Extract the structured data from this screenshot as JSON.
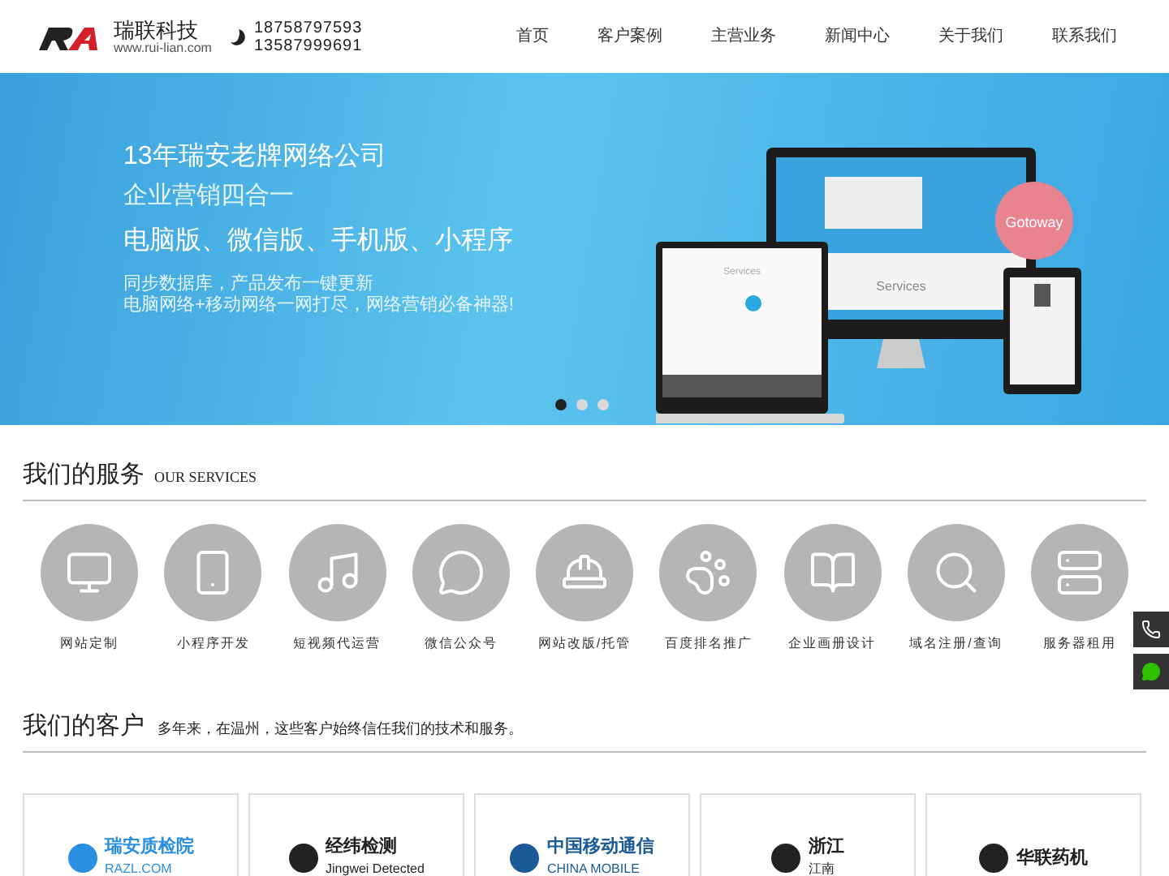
{
  "header": {
    "brand": "瑞联科技",
    "url": "www.rui-lian.com",
    "phones": [
      "18758797593",
      "13587999691"
    ],
    "nav": [
      {
        "label": "首页",
        "selected": false
      },
      {
        "label": "客户案例",
        "selected": false
      },
      {
        "label": "主营业务",
        "selected": false
      },
      {
        "label": "新闻中心",
        "selected": false
      },
      {
        "label": "关于我们",
        "selected": false
      },
      {
        "label": "联系我们",
        "selected": false
      }
    ]
  },
  "banner": {
    "headline": "13年瑞安老牌网络公司",
    "subhead": "企业营销四合一",
    "versions": "电脑版、微信版、手机版、小程序",
    "lines": [
      "同步数据库，产品发布一键更新",
      "电脑网络+移动网络一网打尽，网络营销必备神器!"
    ],
    "mockup": {
      "badge": "Gotoway",
      "monitor_text": "Services",
      "laptop_text": "Services"
    },
    "dots": [
      {
        "selected": true
      },
      {
        "selected": false
      },
      {
        "selected": false
      }
    ]
  },
  "services": {
    "title": "我们的服务",
    "subtitle": "OUR SERVICES",
    "items": [
      {
        "kind": "monitor",
        "label": "网站定制"
      },
      {
        "kind": "phone",
        "label": "小程序开发"
      },
      {
        "kind": "video",
        "label": "短视频代运营"
      },
      {
        "kind": "chat",
        "label": "微信公众号"
      },
      {
        "kind": "maintenance",
        "label": "网站改版/托管"
      },
      {
        "kind": "paw",
        "label": "百度排名推广"
      },
      {
        "kind": "book",
        "label": "企业画册设计"
      },
      {
        "kind": "search",
        "label": "域名注册/查询"
      },
      {
        "kind": "server",
        "label": "服务器租用"
      }
    ]
  },
  "clients": {
    "title": "我们的客户",
    "subtitle": "多年来，在温州，这些客户始终信任我们的技术和服务。",
    "items": [
      {
        "name": "瑞安质检院",
        "caption": "RAZL.COM",
        "color": "#2a8fe0"
      },
      {
        "name": "经纬检测",
        "caption": "Jingwei Detected",
        "color": "#222222"
      },
      {
        "name": "中国移动通信",
        "caption": "CHINA MOBILE",
        "color": "#1a5a96"
      },
      {
        "name": "浙江",
        "caption": "江南",
        "color": "#222222"
      },
      {
        "name": "华联药机",
        "color": "#222222"
      }
    ]
  },
  "float_buttons": [
    {
      "kind": "phone"
    },
    {
      "kind": "wechat"
    }
  ]
}
